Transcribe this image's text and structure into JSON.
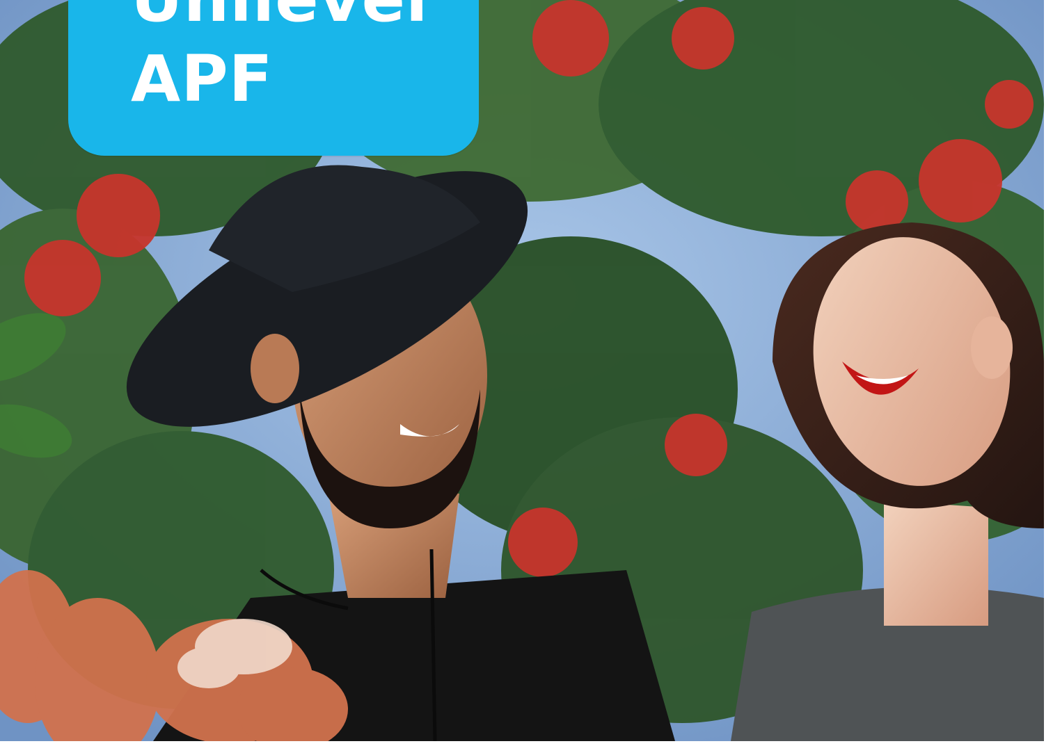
{
  "brand": {
    "line1": "Unilevel",
    "line2": "APF",
    "card_color": "#19b6ea",
    "text_color": "#ffffff"
  },
  "photo": {
    "icon": "photo-icon"
  }
}
